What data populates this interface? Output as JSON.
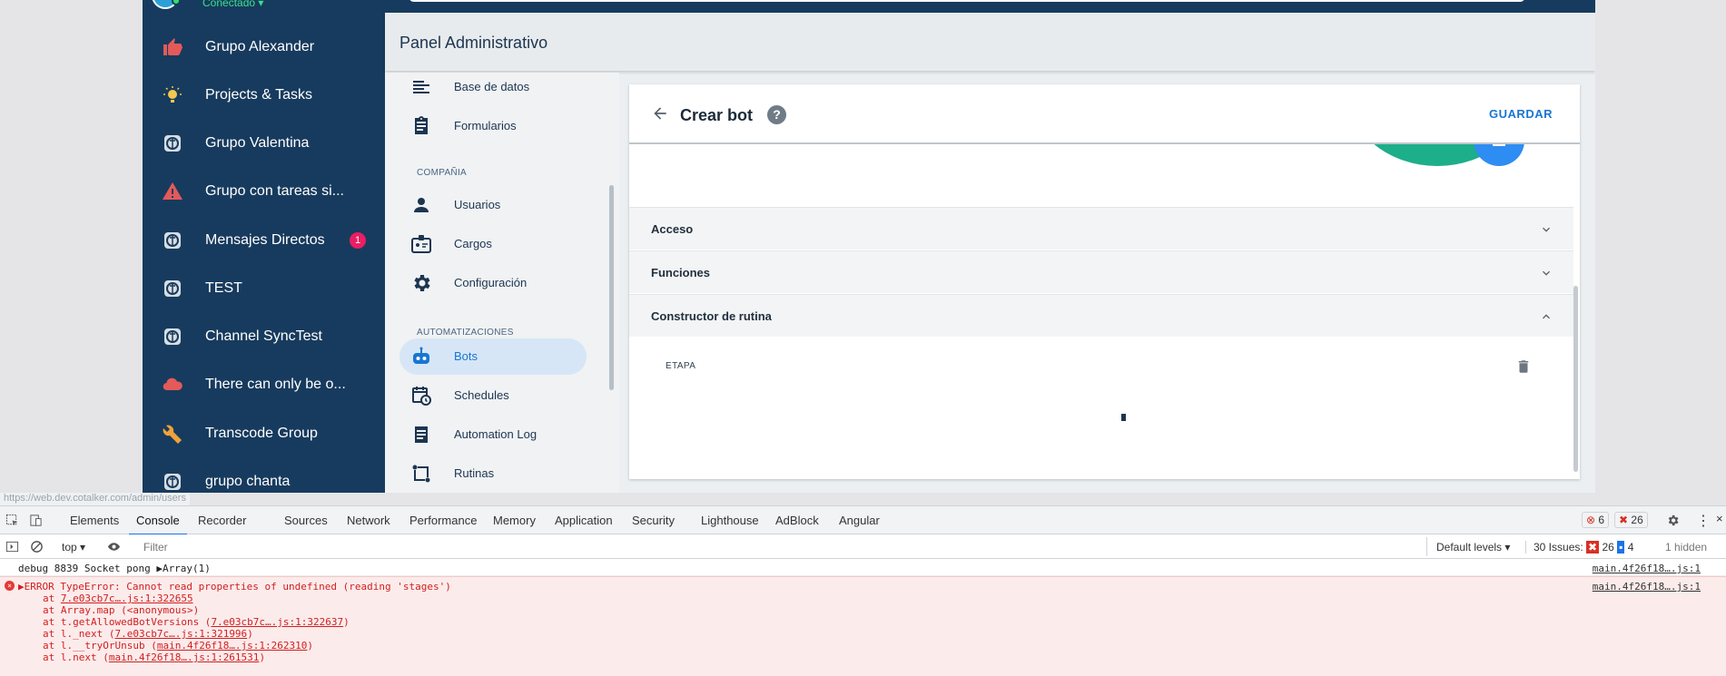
{
  "sidebar": {
    "status": "Conectado",
    "items": [
      {
        "label": "Grupo Alexander",
        "icon": "thumbs-up-icon"
      },
      {
        "label": "Projects & Tasks",
        "icon": "lightbulb-icon"
      },
      {
        "label": "Grupo Valentina",
        "icon": "group-logo-icon"
      },
      {
        "label": "Grupo con tareas si...",
        "icon": "warning-icon"
      },
      {
        "label": "Mensajes Directos",
        "icon": "group-logo-icon",
        "badge": "1"
      },
      {
        "label": "TEST",
        "icon": "group-logo-icon"
      },
      {
        "label": "Channel SyncTest",
        "icon": "group-logo-icon"
      },
      {
        "label": "There can only be o...",
        "icon": "cloud-icon"
      },
      {
        "label": "Transcode Group",
        "icon": "wrench-icon"
      },
      {
        "label": "grupo chanta",
        "icon": "group-logo-icon"
      }
    ]
  },
  "header": {
    "title": "Panel Administrativo"
  },
  "adminnav": {
    "items_top": [
      {
        "label": "Base de datos",
        "icon": "database-lines-icon"
      },
      {
        "label": "Formularios",
        "icon": "clipboard-icon"
      }
    ],
    "section_company": "COMPAÑIA",
    "items_company": [
      {
        "label": "Usuarios",
        "icon": "person-icon"
      },
      {
        "label": "Cargos",
        "icon": "badge-icon"
      },
      {
        "label": "Configuración",
        "icon": "gear-icon"
      }
    ],
    "section_automation": "AUTOMATIZACIONES",
    "items_automation": [
      {
        "label": "Bots",
        "icon": "robot-icon",
        "active": true
      },
      {
        "label": "Schedules",
        "icon": "calendar-clock-icon"
      },
      {
        "label": "Automation Log",
        "icon": "document-icon"
      },
      {
        "label": "Rutinas",
        "icon": "routine-icon"
      }
    ]
  },
  "card": {
    "title": "Crear bot",
    "help": "?",
    "save_label": "GUARDAR",
    "sections": [
      {
        "label": "Acceso",
        "expanded": false
      },
      {
        "label": "Funciones",
        "expanded": false
      },
      {
        "label": "Constructor de rutina",
        "expanded": true
      }
    ],
    "stage_label": "ETAPA"
  },
  "url_hint": "https://web.dev.cotalker.com/admin/users",
  "devtools": {
    "tabs": [
      "Elements",
      "Console",
      "Recorder",
      "Sources",
      "Network",
      "Performance",
      "Memory",
      "Application",
      "Security",
      "Lighthouse",
      "AdBlock",
      "Angular"
    ],
    "active_tab": "Console",
    "error_count": "6",
    "issue_count": "26",
    "context": "top",
    "filter_placeholder": "Filter",
    "levels": "Default levels",
    "issues_label": "30 Issues:",
    "issues_errors": "26",
    "issues_info": "4",
    "hidden": "1 hidden",
    "logs": [
      {
        "text": "debug 8839 Socket pong ▶Array(1)",
        "source": "main.4f26f18….js:1"
      }
    ],
    "error": {
      "text": "▶ERROR TypeError: Cannot read properties of undefined (reading 'stages')",
      "source": "main.4f26f18….js:1",
      "trace": [
        {
          "prefix": "at ",
          "link": "7.e03cb7c….js:1:322655",
          "suffix": ""
        },
        {
          "prefix": "at Array.map (<anonymous>)",
          "link": "",
          "suffix": ""
        },
        {
          "prefix": "at t.getAllowedBotVersions (",
          "link": "7.e03cb7c….js:1:322637",
          "suffix": ")"
        },
        {
          "prefix": "at l._next (",
          "link": "7.e03cb7c….js:1:321996",
          "suffix": ")"
        },
        {
          "prefix": "at l.__tryOrUnsub (",
          "link": "main.4f26f18….js:1:262310",
          "suffix": ")"
        },
        {
          "prefix": "at l.next (",
          "link": "main.4f26f18….js:1:261531",
          "suffix": ")"
        }
      ]
    }
  },
  "colors": {
    "sidebar": "#173b5e",
    "accent": "#1976d2",
    "teal": "#1dae8a",
    "error": "#d01f1f"
  }
}
